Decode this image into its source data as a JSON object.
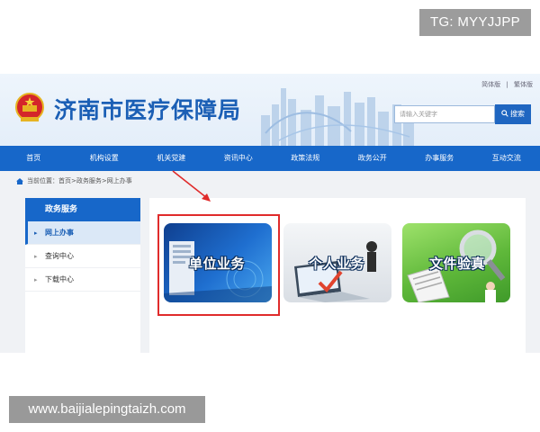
{
  "overlay": {
    "tg_badge": "TG: MYYJJPP",
    "watermark": "www.baijialepingtaizh.com"
  },
  "header": {
    "site_title": "济南市医疗保障局",
    "top_links": [
      "简体版",
      "繁体版"
    ],
    "search_placeholder": "请输入关键字",
    "search_button": "搜索"
  },
  "nav": {
    "items": [
      "首页",
      "机构设置",
      "机关党建",
      "资讯中心",
      "政策法规",
      "政务公开",
      "办事服务",
      "互动交流"
    ]
  },
  "breadcrumb": "当前位置：首页>政务服务>网上办事",
  "sidebar": {
    "title": "政务服务",
    "items": [
      {
        "label": "网上办事",
        "active": true
      },
      {
        "label": "查询中心",
        "active": false
      },
      {
        "label": "下载中心",
        "active": false
      }
    ]
  },
  "cards": [
    {
      "label": "单位业务"
    },
    {
      "label": "个人业务"
    },
    {
      "label": "文件验真"
    }
  ],
  "colors": {
    "brand_blue": "#1767c9",
    "title_blue": "#1b5fb5",
    "highlight_red": "#e02b2b"
  }
}
